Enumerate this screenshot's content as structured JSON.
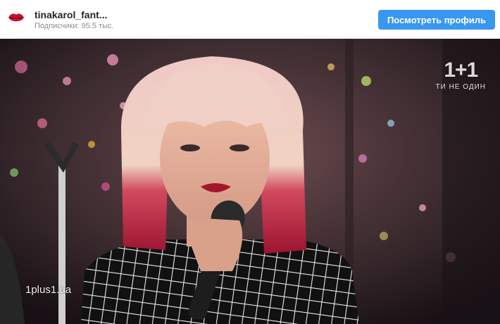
{
  "post_header": {
    "username": "tinakarol_fant...",
    "followers_text": "Подписчики: 95.5 тыс.",
    "view_profile_label": "Посмотреть профиль",
    "avatar_icon": "lips-icon"
  },
  "video": {
    "channel_logo": "1+1",
    "channel_slogan": "ТИ НЕ ОДИН",
    "watermark": "1plus1.ua"
  },
  "colors": {
    "accent_button": "#3897f0",
    "username": "#262626",
    "muted_text": "#8e8e8e"
  }
}
